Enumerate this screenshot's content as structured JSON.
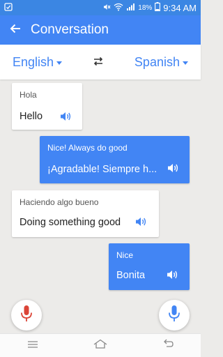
{
  "status": {
    "battery": "18%",
    "time": "9:34 AM"
  },
  "app_bar": {
    "title": "Conversation"
  },
  "languages": {
    "source": "English",
    "target": "Spanish"
  },
  "messages": [
    {
      "source": "Hola",
      "translation": "Hello"
    },
    {
      "source": "Nice! Always do good",
      "translation": "¡Agradable! Siempre h..."
    },
    {
      "source": "Haciendo algo bueno",
      "translation": "Doing something good"
    },
    {
      "source": "Nice",
      "translation": "Bonita"
    }
  ],
  "colors": {
    "accent": "#4285f4",
    "mic_left": "#db4437",
    "mic_right": "#4285f4"
  }
}
